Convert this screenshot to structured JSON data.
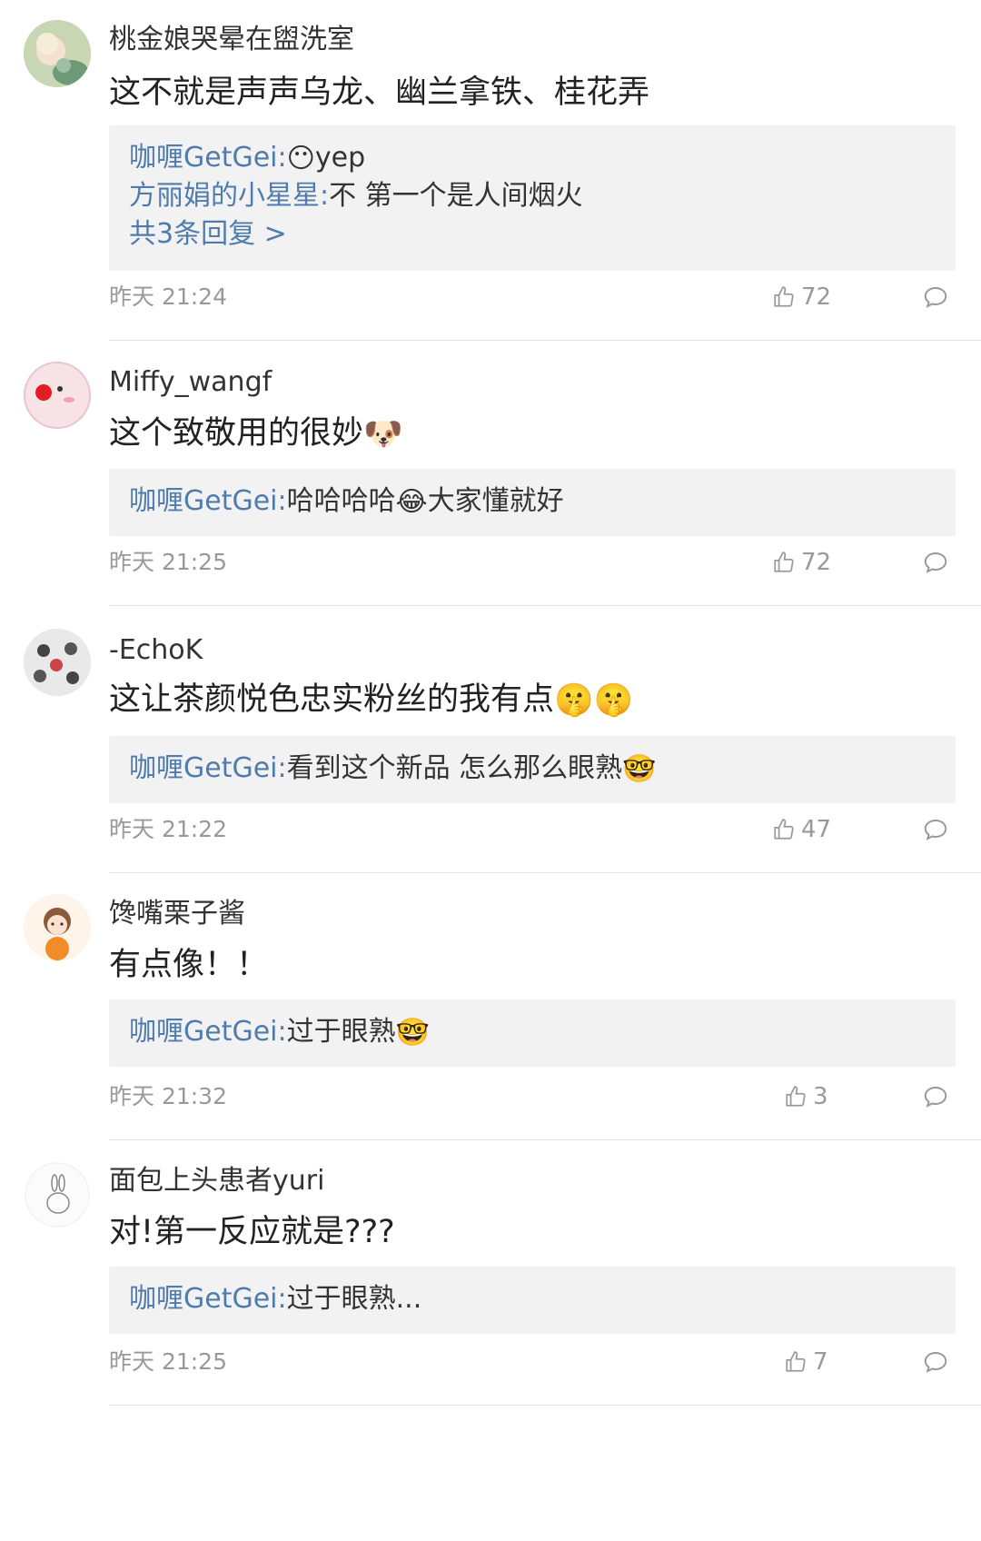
{
  "comments": [
    {
      "author": "桃金娘哭晕在盥洗室",
      "text": "这不就是声声乌龙、幽兰拿铁、桂花弄",
      "replies": [
        {
          "author": "咖喱GetGei:",
          "text": "yep",
          "emoji": "😶"
        },
        {
          "author": "方丽娟的小星星:",
          "text": "不 第一个是人间烟火",
          "emoji": ""
        }
      ],
      "more": "共3条回复 >",
      "time": "昨天 21:24",
      "likes": "72"
    },
    {
      "author": "Miffy_wangf",
      "text": "这个致敬用的很妙",
      "text_emoji": "🐶",
      "replies": [
        {
          "author": "咖喱GetGei:",
          "text": "哈哈哈哈",
          "emoji": "😂",
          "text2": "大家懂就好"
        }
      ],
      "time": "昨天 21:25",
      "likes": "72"
    },
    {
      "author": "-EchoK",
      "text": "这让茶颜悦色忠实粉丝的我有点",
      "text_emoji": "🤫🤫",
      "replies": [
        {
          "author": "咖喱GetGei:",
          "text": "看到这个新品 怎么那么眼熟",
          "emoji": "🤓"
        }
      ],
      "time": "昨天 21:22",
      "likes": "47"
    },
    {
      "author": "馋嘴栗子酱",
      "text": "有点像！！",
      "replies": [
        {
          "author": "咖喱GetGei:",
          "text": "过于眼熟",
          "emoji": "🤓"
        }
      ],
      "time": "昨天 21:32",
      "likes": "3"
    },
    {
      "author": "面包上头患者yuri",
      "text": "对!第一反应就是???",
      "replies": [
        {
          "author": "咖喱GetGei:",
          "text": "过于眼熟...",
          "emoji": ""
        }
      ],
      "time": "昨天 21:25",
      "likes": "7"
    }
  ],
  "icons": {
    "like": "thumbs-up-icon",
    "comment": "comment-bubble-icon"
  },
  "colors": {
    "link": "#4f7cad",
    "meta": "#999999",
    "reply_bg": "#f2f2f2"
  }
}
